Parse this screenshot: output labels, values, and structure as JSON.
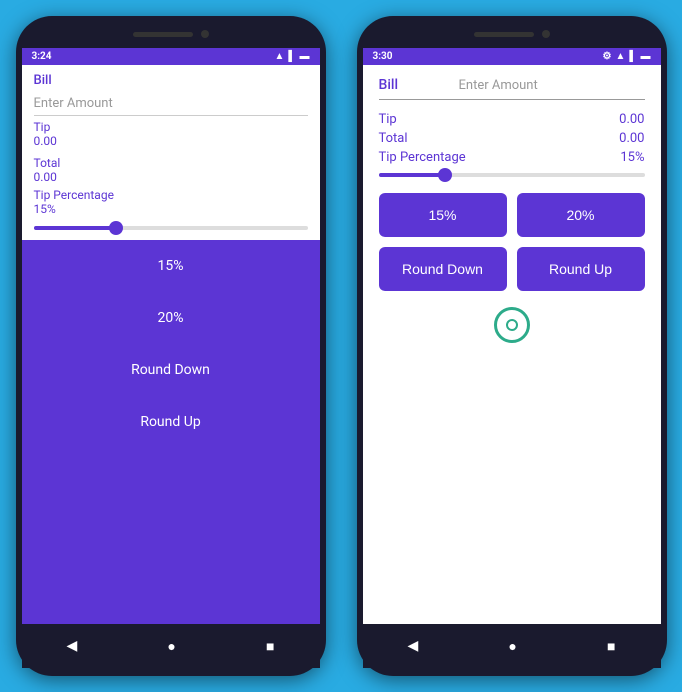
{
  "phone_left": {
    "time": "3:24",
    "bill_label": "Bill",
    "bill_placeholder": "Enter Amount",
    "tip_label": "Tip",
    "tip_value": "0.00",
    "total_label": "Total",
    "total_value": "0.00",
    "tip_percentage_label": "Tip Percentage",
    "tip_percentage_value": "15%",
    "slider_fill_width": "30%",
    "slider_thumb_left": "calc(30% - 7px)",
    "dropdown_items": [
      "15%",
      "20%",
      "Round Down",
      "Round Up"
    ],
    "nav_back": "◀",
    "nav_home": "●",
    "nav_recent": "■"
  },
  "phone_right": {
    "time": "3:30",
    "bill_label": "Bill",
    "bill_placeholder": "Enter Amount",
    "tip_label": "Tip",
    "tip_value": "0.00",
    "total_label": "Total",
    "total_value": "0.00",
    "tip_percentage_label": "Tip Percentage",
    "tip_percentage_value": "15%",
    "btn_15": "15%",
    "btn_20": "20%",
    "btn_round_down": "Round Down",
    "btn_round_up": "Round Up",
    "nav_back": "◀",
    "nav_home": "●",
    "nav_recent": "■"
  },
  "colors": {
    "purple": "#5c35d4",
    "teal": "#2dab8a",
    "background": "#29ABE2"
  }
}
